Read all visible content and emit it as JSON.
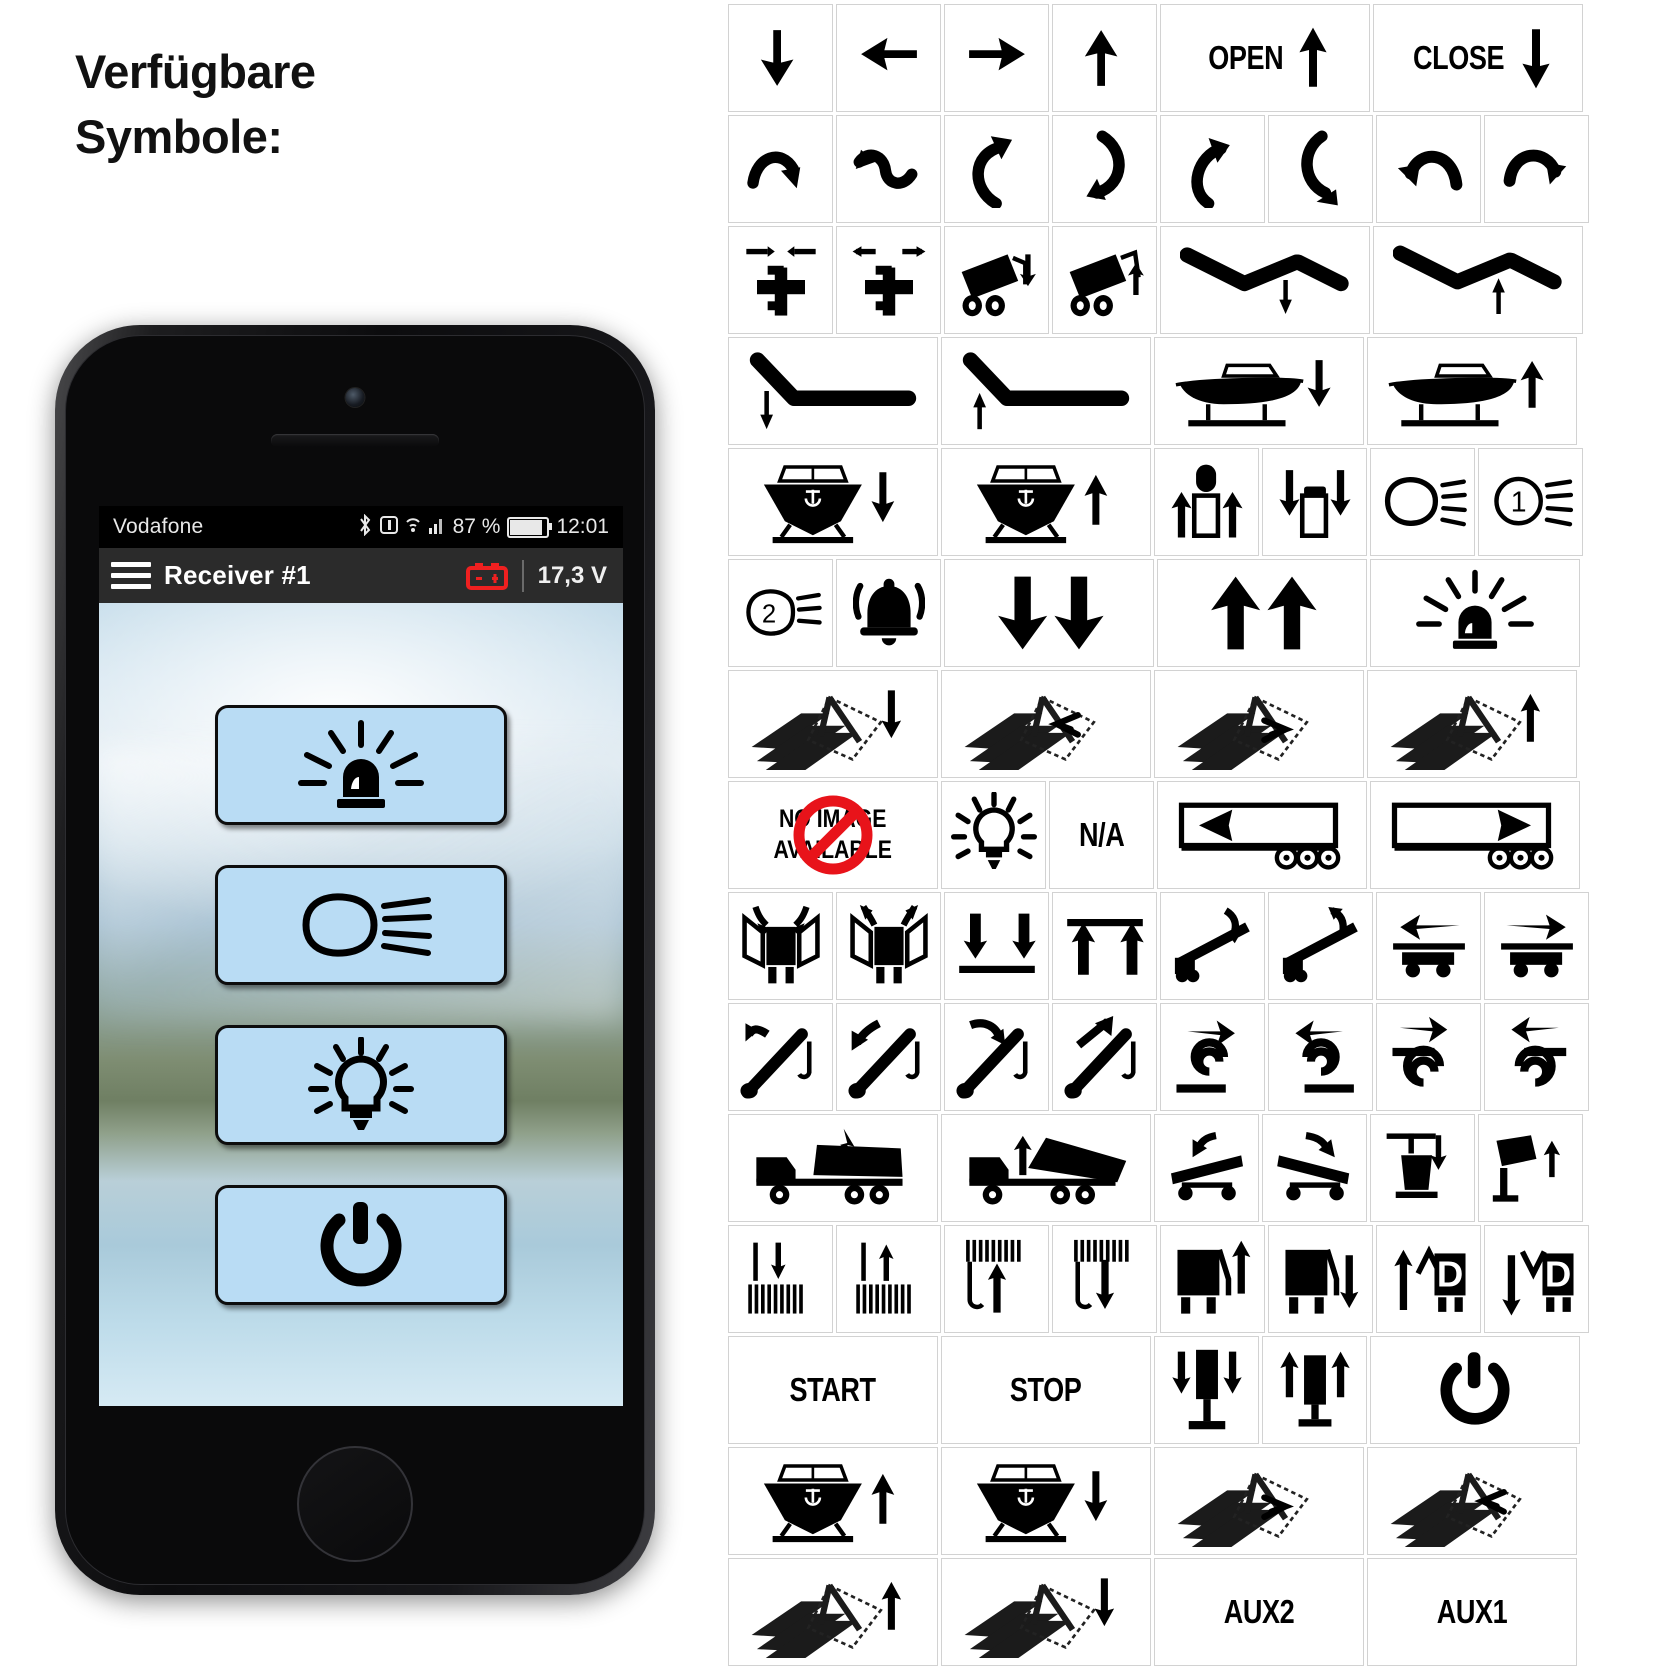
{
  "heading": {
    "line1": "Verfügbare",
    "line2": "Symbole:"
  },
  "phone": {
    "statusbar": {
      "carrier": "Vodafone",
      "bluetooth_icon": "bluetooth-icon",
      "alarm_icon": "alarm-icon",
      "wifi_icon": "wifi-icon",
      "signal_icon": "signal-bars-icon",
      "battery_percent": "87 %",
      "battery_icon": "battery-icon",
      "time": "12:01"
    },
    "appbar": {
      "menu_icon": "hamburger-menu-icon",
      "title": "Receiver #1",
      "battery_icon": "car-battery-icon",
      "battery_icon_color": "#ef2020",
      "voltage": "17,3 V"
    },
    "buttons": [
      {
        "name": "beacon-light-button",
        "icon": "beacon-light-icon"
      },
      {
        "name": "work-light-button",
        "icon": "headlight-beam-icon"
      },
      {
        "name": "lamp-button",
        "icon": "light-bulb-icon"
      },
      {
        "name": "power-button",
        "icon": "power-icon"
      }
    ],
    "button_color": "#b9dcf4"
  },
  "symbol_grid": {
    "rows": [
      {
        "cols": 6,
        "widths": [
          105,
          105,
          105,
          105,
          210,
          210
        ],
        "cells": [
          {
            "name": "arrow-down-icon",
            "icon": "arrow-down"
          },
          {
            "name": "arrow-left-icon",
            "icon": "arrow-left"
          },
          {
            "name": "arrow-right-icon",
            "icon": "arrow-right"
          },
          {
            "name": "arrow-up-icon",
            "icon": "arrow-up"
          },
          {
            "name": "open-up-label",
            "icon": "text-arrow-up",
            "text": "OPEN"
          },
          {
            "name": "close-down-label",
            "icon": "text-arrow-down",
            "text": "CLOSE"
          }
        ]
      },
      {
        "cols": 8,
        "widths": [
          105,
          105,
          105,
          105,
          105,
          105,
          105,
          105
        ],
        "cells": [
          {
            "name": "curve-right-down-icon",
            "icon": "curve-a"
          },
          {
            "name": "curve-left-down-icon",
            "icon": "curve-b"
          },
          {
            "name": "rotate-up-right-icon",
            "icon": "curve-c"
          },
          {
            "name": "rotate-down-left-icon",
            "icon": "curve-d"
          },
          {
            "name": "rotate-ccw-up-icon",
            "icon": "curve-e"
          },
          {
            "name": "rotate-cw-down-icon",
            "icon": "curve-f"
          },
          {
            "name": "curve-left-arrow-icon",
            "icon": "curve-g"
          },
          {
            "name": "curve-right-arrow-icon",
            "icon": "curve-h"
          }
        ]
      },
      {
        "cols": 6,
        "widths": [
          105,
          105,
          105,
          105,
          210,
          210
        ],
        "cells": [
          {
            "name": "axle-retract-icon",
            "icon": "axle-in"
          },
          {
            "name": "axle-extend-icon",
            "icon": "axle-out"
          },
          {
            "name": "tipper-down-icon",
            "icon": "tipper-down"
          },
          {
            "name": "tipper-up-icon",
            "icon": "tipper-up"
          },
          {
            "name": "ramp-center-down-icon",
            "icon": "ramp-c-down"
          },
          {
            "name": "ramp-center-up-icon",
            "icon": "ramp-c-up"
          }
        ]
      },
      {
        "cols": 4,
        "widths": [
          210,
          210,
          210,
          210
        ],
        "cells": [
          {
            "name": "ramp-left-down-icon",
            "icon": "ramp-l-down"
          },
          {
            "name": "ramp-left-up-icon",
            "icon": "ramp-l-up"
          },
          {
            "name": "boat-side-down-icon",
            "icon": "boat-side-down"
          },
          {
            "name": "boat-side-up-icon",
            "icon": "boat-side-up"
          }
        ]
      },
      {
        "cols": 6,
        "widths": [
          210,
          210,
          105,
          105,
          105,
          105
        ],
        "cells": [
          {
            "name": "boat-front-down-icon",
            "icon": "boat-front-down"
          },
          {
            "name": "boat-front-up-icon",
            "icon": "boat-front-up"
          },
          {
            "name": "cylinder-extend-icon",
            "icon": "cyl-up"
          },
          {
            "name": "cylinder-retract-icon",
            "icon": "cyl-down"
          },
          {
            "name": "headlight-icon",
            "icon": "headlight"
          },
          {
            "name": "headlight-1-icon",
            "icon": "headlight-1"
          }
        ]
      },
      {
        "cols": 6,
        "widths": [
          105,
          105,
          210,
          210,
          210,
          118
        ],
        "cells": [
          {
            "name": "headlight-2-icon",
            "icon": "headlight-2"
          },
          {
            "name": "horn-bell-icon",
            "icon": "bell"
          },
          {
            "name": "double-down-icon",
            "icon": "double-down"
          },
          {
            "name": "double-up-icon",
            "icon": "double-up"
          },
          {
            "name": "beacon-icon",
            "icon": "beacon"
          },
          {
            "name": "spacer-cell",
            "icon": "empty"
          }
        ]
      },
      {
        "cols": 4,
        "widths": [
          210,
          210,
          210,
          210
        ],
        "cells": [
          {
            "name": "tarp-close-down-icon",
            "icon": "tarp-down"
          },
          {
            "name": "tarp-pull-left-icon",
            "icon": "tarp-left"
          },
          {
            "name": "tarp-pull-right-icon",
            "icon": "tarp-right"
          },
          {
            "name": "tarp-open-up-icon",
            "icon": "tarp-up"
          }
        ]
      },
      {
        "cols": 5,
        "widths": [
          210,
          105,
          105,
          210,
          210
        ],
        "cells": [
          {
            "name": "no-image-available-placeholder",
            "icon": "no-image",
            "text_line1": "NO IMAGE",
            "text_line2": "AVAILABLE"
          },
          {
            "name": "lamp-icon",
            "icon": "bulb-small"
          },
          {
            "name": "not-available-label",
            "icon": "text-only",
            "text": "N/A"
          },
          {
            "name": "trailer-move-left-icon",
            "icon": "trailer-left"
          },
          {
            "name": "trailer-move-right-icon",
            "icon": "trailer-right"
          }
        ]
      },
      {
        "cols": 8,
        "widths": [
          105,
          105,
          105,
          105,
          105,
          105,
          105,
          105
        ],
        "cells": [
          {
            "name": "side-doors-close-icon",
            "icon": "doors-close"
          },
          {
            "name": "side-doors-open-icon",
            "icon": "doors-open"
          },
          {
            "name": "deck-lower-icon",
            "icon": "deck-down"
          },
          {
            "name": "deck-raise-icon",
            "icon": "deck-up"
          },
          {
            "name": "ramp-tilt-down-icon",
            "icon": "tilt-down"
          },
          {
            "name": "ramp-tilt-up-icon",
            "icon": "tilt-up"
          },
          {
            "name": "deck-slide-left-icon",
            "icon": "slide-left"
          },
          {
            "name": "deck-slide-right-icon",
            "icon": "slide-right"
          }
        ]
      },
      {
        "cols": 8,
        "widths": [
          105,
          105,
          105,
          105,
          105,
          105,
          105,
          105
        ],
        "cells": [
          {
            "name": "crane-arm-up-left-icon",
            "icon": "crane-ul"
          },
          {
            "name": "crane-arm-down-left-icon",
            "icon": "crane-dl"
          },
          {
            "name": "crane-arm-down-right-icon",
            "icon": "crane-dr"
          },
          {
            "name": "crane-arm-up-right-icon",
            "icon": "crane-ur"
          },
          {
            "name": "winch-unroll-right-icon",
            "icon": "roll-a"
          },
          {
            "name": "winch-roll-left-icon",
            "icon": "roll-b"
          },
          {
            "name": "winch-unroll-out-icon",
            "icon": "roll-c"
          },
          {
            "name": "winch-roll-in-icon",
            "icon": "roll-d"
          }
        ]
      },
      {
        "cols": 6,
        "widths": [
          210,
          210,
          105,
          105,
          105,
          105
        ],
        "cells": [
          {
            "name": "dump-truck-lower-icon",
            "icon": "dump-down"
          },
          {
            "name": "dump-truck-raise-icon",
            "icon": "dump-up"
          },
          {
            "name": "platform-tilt-left-icon",
            "icon": "plat-left"
          },
          {
            "name": "platform-tilt-right-icon",
            "icon": "plat-right"
          },
          {
            "name": "bin-lifter-down-icon",
            "icon": "bin-down"
          },
          {
            "name": "bin-lifter-up-icon",
            "icon": "bin-up"
          }
        ]
      },
      {
        "cols": 8,
        "widths": [
          105,
          105,
          105,
          105,
          105,
          105,
          105,
          105
        ],
        "cells": [
          {
            "name": "brush-lower-icon",
            "icon": "brush-down"
          },
          {
            "name": "brush-raise-icon",
            "icon": "brush-up"
          },
          {
            "name": "hook-raise-icon",
            "icon": "hook-up"
          },
          {
            "name": "hook-lower-icon",
            "icon": "hook-down"
          },
          {
            "name": "container-tip-up-icon",
            "icon": "cont-up"
          },
          {
            "name": "container-tip-down-icon",
            "icon": "cont-down"
          },
          {
            "name": "door-d-up-icon",
            "icon": "d-up"
          },
          {
            "name": "door-d-down-icon",
            "icon": "d-down"
          }
        ]
      },
      {
        "cols": 5,
        "widths": [
          210,
          210,
          105,
          105,
          210
        ],
        "cells": [
          {
            "name": "start-label",
            "icon": "text-only",
            "text": "START"
          },
          {
            "name": "stop-label",
            "icon": "text-only",
            "text": "STOP"
          },
          {
            "name": "support-leg-down-icon",
            "icon": "leg-down"
          },
          {
            "name": "support-leg-up-icon",
            "icon": "leg-up"
          },
          {
            "name": "power-icon",
            "icon": "power"
          }
        ]
      },
      {
        "cols": 4,
        "widths": [
          210,
          210,
          210,
          210
        ],
        "cells": [
          {
            "name": "boat-front-raise-icon",
            "icon": "boat-front-up"
          },
          {
            "name": "boat-front-lower-icon",
            "icon": "boat-front-down"
          },
          {
            "name": "tarp-pull-right-2-icon",
            "icon": "tarp-right"
          },
          {
            "name": "tarp-pull-left-2-icon",
            "icon": "tarp-left"
          }
        ]
      },
      {
        "cols": 4,
        "widths": [
          210,
          210,
          210,
          210
        ],
        "cells": [
          {
            "name": "tarp-open-up-2-icon",
            "icon": "tarp-up"
          },
          {
            "name": "tarp-close-down-2-icon",
            "icon": "tarp-down"
          },
          {
            "name": "aux2-label",
            "icon": "text-only",
            "text": "AUX2"
          },
          {
            "name": "aux1-label",
            "icon": "text-only",
            "text": "AUX1"
          }
        ]
      }
    ]
  }
}
